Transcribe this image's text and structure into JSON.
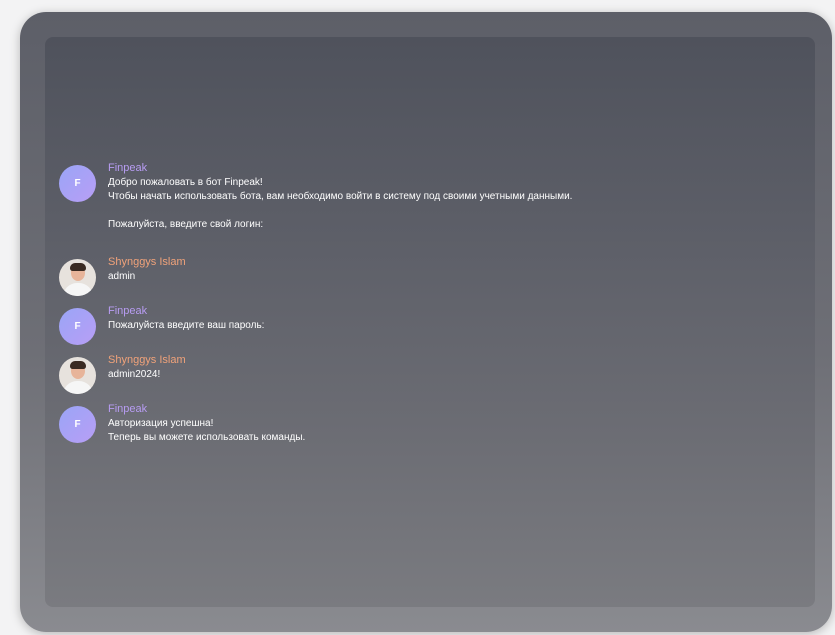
{
  "colors": {
    "bot_name": "#b79cf2",
    "user_name": "#f0a27a",
    "message_text": "#ffffff",
    "device_frame": "#6e6f76",
    "screen_bg": "#5d5f68"
  },
  "messages": [
    {
      "sender": "Finpeak",
      "avatar_letter": "F",
      "lines": [
        "Добро пожаловать в бот Finpeak!",
        "Чтобы начать использовать бота, вам необходимо войти в систему под своими учетными данными.",
        "",
        "Пожалуйста, введите свой логин:"
      ]
    },
    {
      "sender": "Shynggys Islam",
      "avatar_icon": "user-photo-icon",
      "lines": [
        "admin"
      ]
    },
    {
      "sender": "Finpeak",
      "avatar_letter": "F",
      "lines": [
        "Пожалуйста введите ваш пароль:"
      ]
    },
    {
      "sender": "Shynggys Islam",
      "avatar_icon": "user-photo-icon",
      "lines": [
        "admin2024!"
      ]
    },
    {
      "sender": "Finpeak",
      "avatar_letter": "F",
      "lines": [
        "Авторизация успешна!",
        "Теперь вы можете использовать команды."
      ]
    }
  ]
}
